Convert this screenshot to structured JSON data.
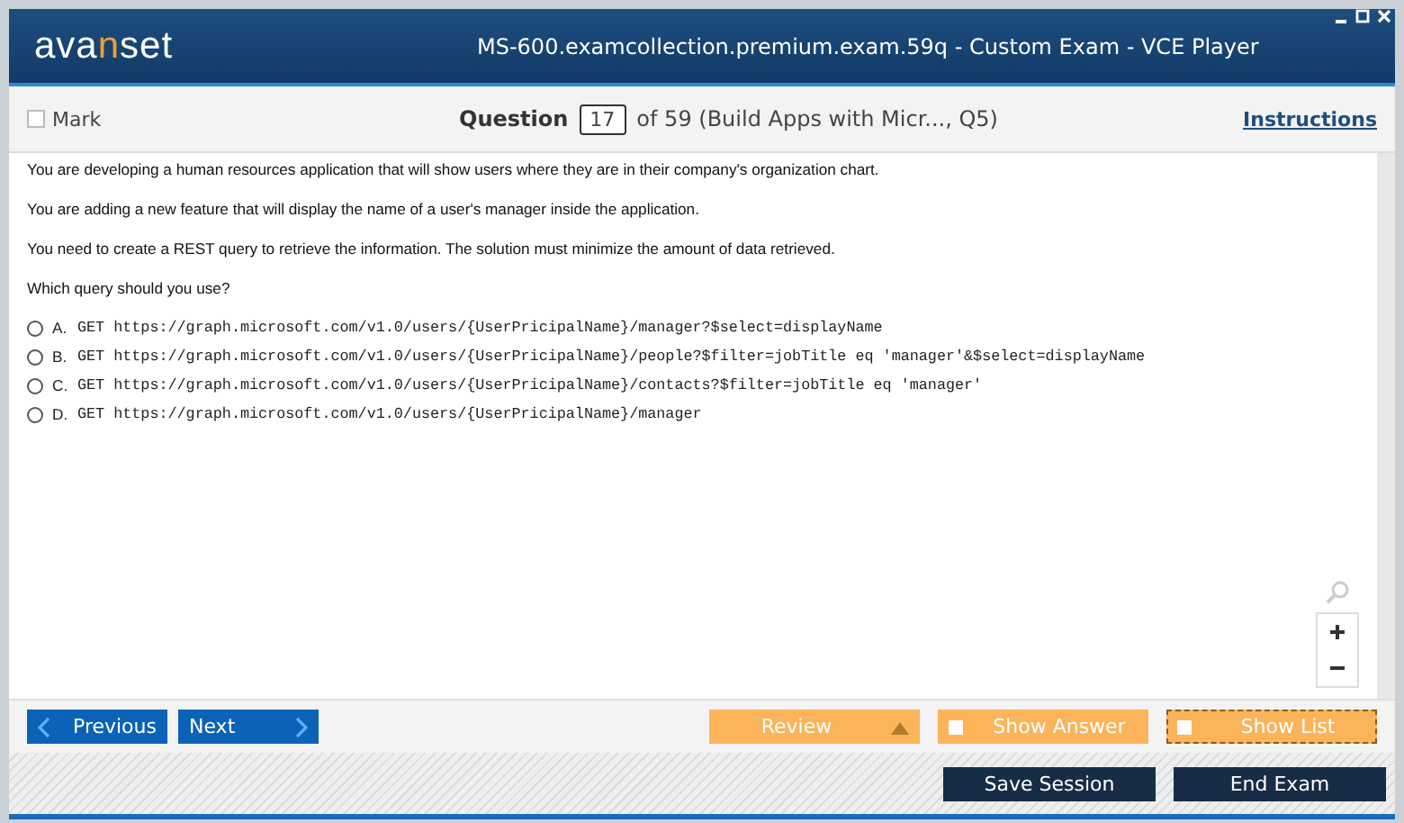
{
  "window": {
    "logo": [
      {
        "text": "ava",
        "accent": false
      },
      {
        "text": "n",
        "accent": true
      },
      {
        "text": "set",
        "accent": false
      }
    ],
    "title": "MS-600.examcollection.premium.exam.59q - Custom Exam - VCE Player"
  },
  "toolbar": {
    "mark": {
      "label": "Mark",
      "checked": false
    },
    "question_label": "Question",
    "question_number": "17",
    "question_of": "of 59 (Build Apps with Micr..., Q5)",
    "instructions": "Instructions"
  },
  "question": {
    "paragraphs": [
      "You are developing a human resources application that will show users where they are in their company's organization chart.",
      "You are adding a new feature that will display the name of a user's manager inside the application.",
      "You need to create a REST query to retrieve the information. The solution must minimize the amount of data retrieved.",
      "Which query should you use?"
    ],
    "options": [
      {
        "letter": "A.",
        "text": "GET https://graph.microsoft.com/v1.0/users/{UserPricipalName}/manager?$select=displayName",
        "selected": false
      },
      {
        "letter": "B.",
        "text": "GET https://graph.microsoft.com/v1.0/users/{UserPricipalName}/people?$filter=jobTitle eq 'manager'&$select=displayName",
        "selected": false
      },
      {
        "letter": "C.",
        "text": "GET https://graph.microsoft.com/v1.0/users/{UserPricipalName}/contacts?$filter=jobTitle eq 'manager'",
        "selected": false
      },
      {
        "letter": "D.",
        "text": "GET https://graph.microsoft.com/v1.0/users/{UserPricipalName}/manager",
        "selected": false
      }
    ]
  },
  "nav": {
    "previous": "Previous",
    "next": "Next",
    "review": "Review",
    "show_answer": {
      "label": "Show Answer",
      "checked": false
    },
    "show_list": {
      "label": "Show List",
      "checked": false
    }
  },
  "footer": {
    "save": "Save Session",
    "end": "End Exam"
  }
}
